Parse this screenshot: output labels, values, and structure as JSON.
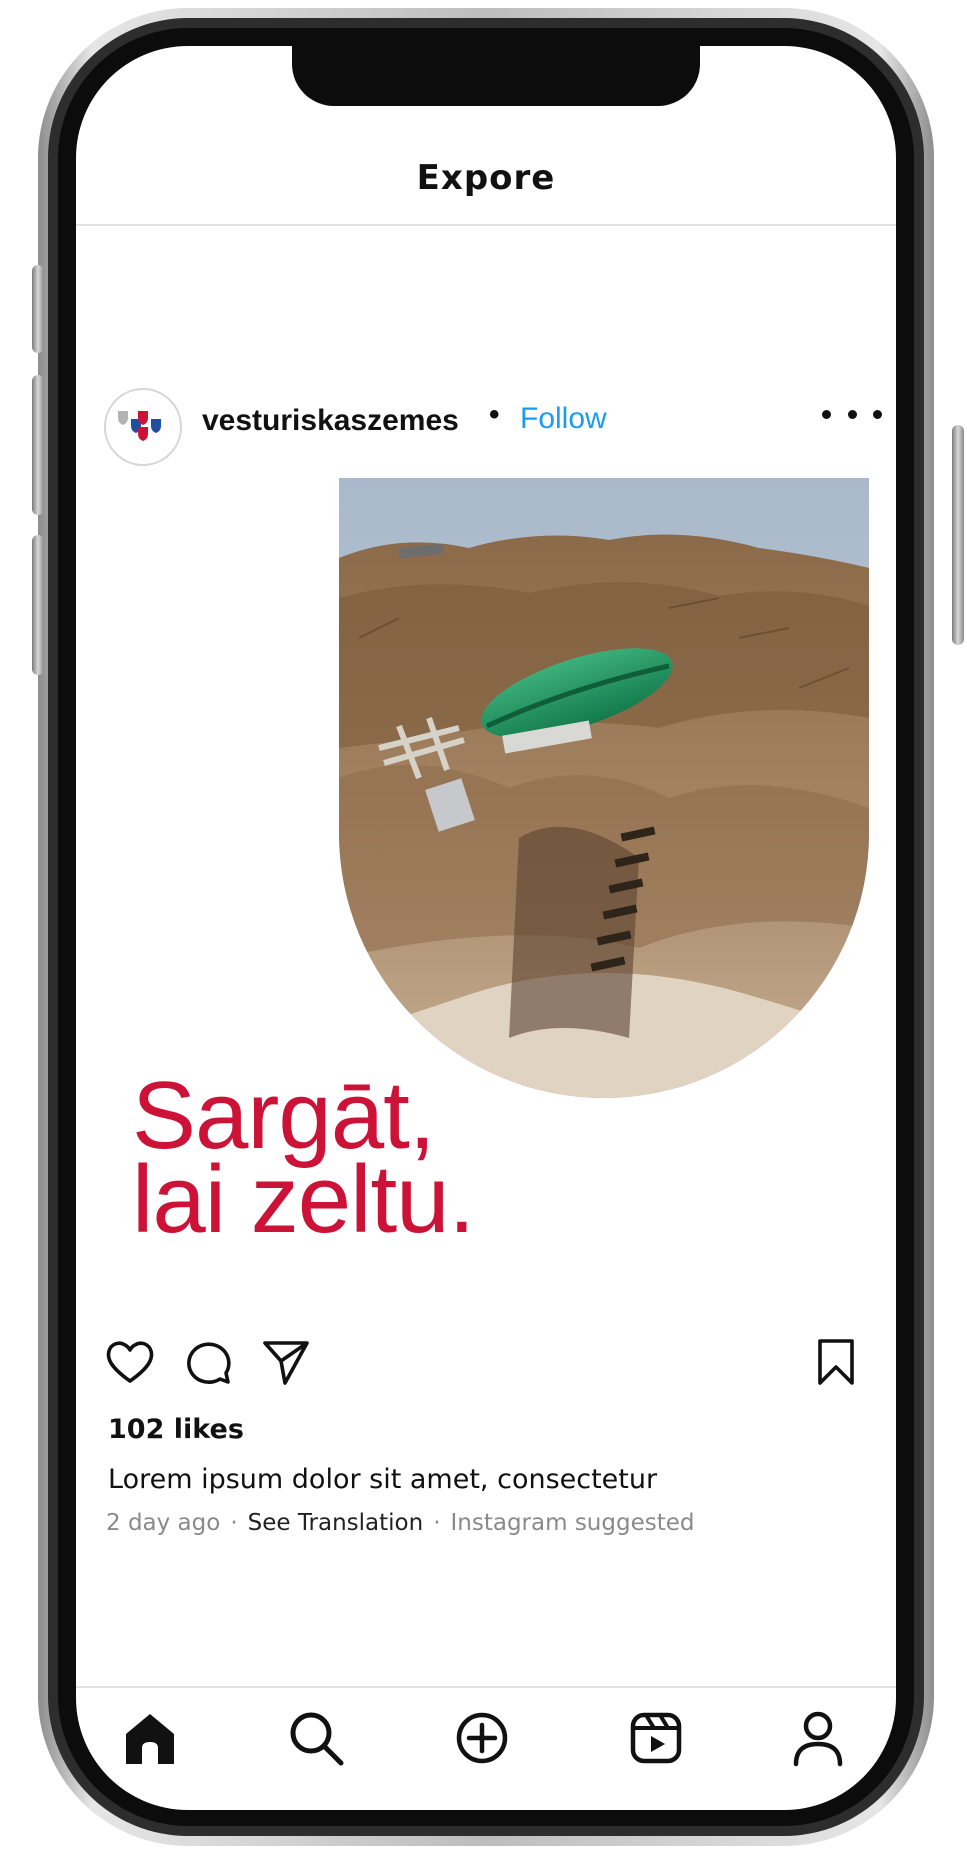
{
  "header": {
    "title": "Expore"
  },
  "post": {
    "username": "vesturiskaszemes",
    "separator": "•",
    "follow_label": "Follow",
    "headline_line1": "Sargāt,",
    "headline_line2": "lai zeltu.",
    "likes": "102 likes",
    "caption": "Lorem ipsum dolor sit amet, consectetur",
    "time": "2 day ago",
    "see_translation": "See Translation",
    "suggested": "Instagram suggested",
    "meta_separator": "·"
  },
  "icons": {
    "like": "heart-icon",
    "comment": "comment-icon",
    "share": "send-icon",
    "save": "bookmark-icon",
    "more": "more-icon"
  },
  "nav": [
    "home-icon",
    "search-icon",
    "create-icon",
    "reels-icon",
    "profile-icon"
  ],
  "colors": {
    "accent": "#cc1236",
    "link": "#1d9bf0",
    "shield_blue": "#1f4fa0",
    "shield_gray": "#b3b3b3"
  }
}
